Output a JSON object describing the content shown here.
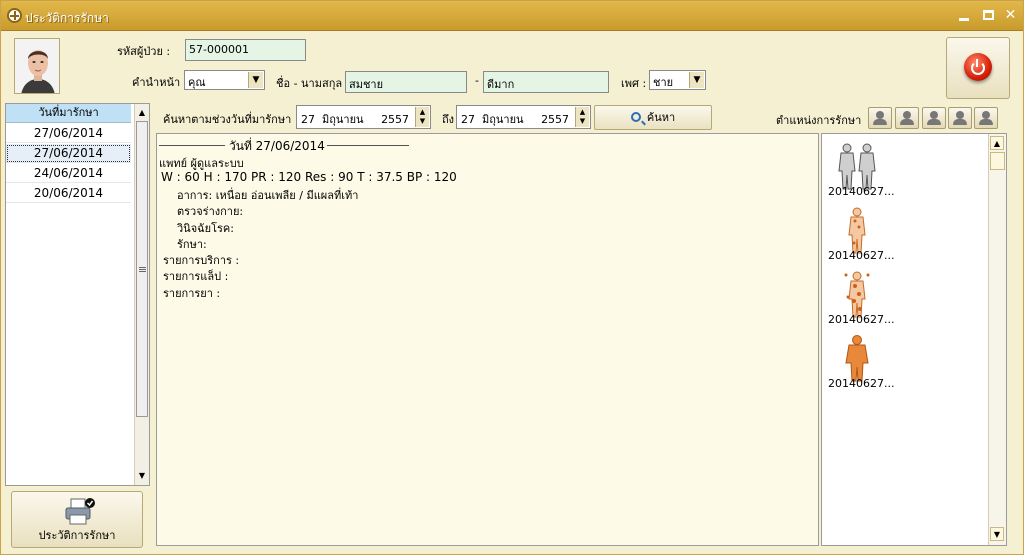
{
  "window": {
    "title": "ประวัติการรักษา"
  },
  "patient": {
    "id_label": "รหัสผู้ป่วย :",
    "id_value": "57-000001",
    "prefix_label": "คำนำหน้า :",
    "prefix_value": "คุณ",
    "name_label": "ชื่อ - นามสกุล :",
    "first_name": "สมชาย",
    "dash": "-",
    "last_name": "ดีมาก",
    "gender_label": "เพศ :",
    "gender_value": "ชาย"
  },
  "visit_list": {
    "header": "วันที่มารักษา",
    "dates": [
      "27/06/2014",
      "27/06/2014",
      "24/06/2014",
      "20/06/2014"
    ],
    "selected_index": 1
  },
  "search": {
    "label": "ค้นหาตามช่วงวันที่มารักษา",
    "from": {
      "day": "27",
      "month": "มิถุนายน",
      "year": "2557"
    },
    "to_label": "ถึง",
    "to": {
      "day": "27",
      "month": "มิถุนายน",
      "year": "2557"
    },
    "button_label": "ค้นหา"
  },
  "body_positions": {
    "label": "ตำแหน่งการรักษา",
    "count": 5
  },
  "detail": {
    "date_heading": "วันที่ 27/06/2014",
    "doctor": "แพทย์ ผู้ดูแลระบบ",
    "vitals": "W : 60   H : 170   PR : 120   Res : 90   T : 37.5   BP : 120",
    "symptom": "อาการ:   เหนื่อย อ่อนเพลีย / มีแผลที่เท้า",
    "physical_exam": "ตรวจร่างกาย:",
    "diagnosis": "วินิจฉัยโรค:",
    "treatment": "รักษา:",
    "services": "รายการบริการ  :",
    "labs": "รายการแล็ป  :",
    "drugs": "รายการยา  :"
  },
  "images": [
    {
      "label": "20140627...",
      "type": "body-outline"
    },
    {
      "label": "20140627...",
      "type": "body-orange-small"
    },
    {
      "label": "20140627...",
      "type": "body-orange-dots"
    },
    {
      "label": "20140627...",
      "type": "body-orange-full"
    }
  ],
  "footer": {
    "history_button_label": "ประวัติการรักษา"
  },
  "colors": {
    "accent": "#d6a43a",
    "panel_bg": "#f6f0d2",
    "field_bg": "#e5f5e5",
    "header_blue": "#bfe0f5"
  }
}
